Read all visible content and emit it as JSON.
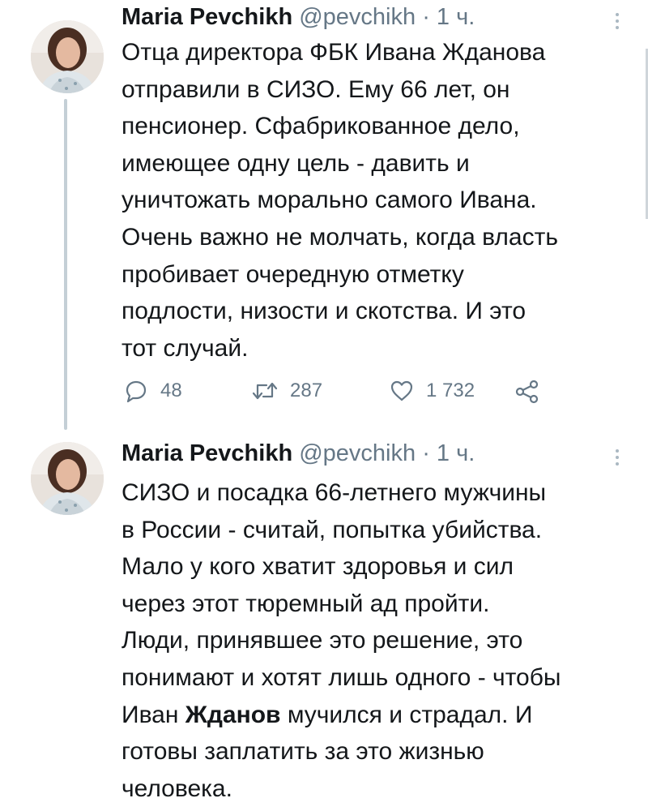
{
  "colors": {
    "text": "#14171a",
    "secondary": "#657786",
    "thread_line": "#c4cfd6"
  },
  "tweets": [
    {
      "author": "Maria Pevchikh",
      "handle": "@pevchikh",
      "separator": "·",
      "time": "1 ч.",
      "text": "Отца директора ФБК Ивана Жданова\nотправили в СИЗО. Ему 66 лет, он\nпенсионер. Сфабрикованное дело,\nимеющее одну цель - давить и\nуничтожать морально самого Ивана.\nОчень важно не молчать, когда власть\nпробивает очередную отметку\nподлости, низости и скотства. И это\nтот случай.",
      "replies": "48",
      "retweets": "287",
      "likes": "1 732",
      "icons": [
        "more-icon",
        "reply-icon",
        "retweet-icon",
        "like-icon",
        "share-icon"
      ]
    },
    {
      "author": "Maria Pevchikh",
      "handle": "@pevchikh",
      "separator": "·",
      "time": "1 ч.",
      "text_before": "СИЗО и посадка 66-летнего мужчины\nв России - считай, попытка убийства.\nМало у кого хватит здоровья и сил\nчерез этот тюремный ад пройти.\nЛюди, принявшее это решение, это\nпонимают и хотят лишь одного - чтобы\nИван ",
      "text_bold": "Жданов",
      "text_after": " мучился и страдал. И\nготовы заплатить за это жизнью\nчеловека."
    }
  ]
}
